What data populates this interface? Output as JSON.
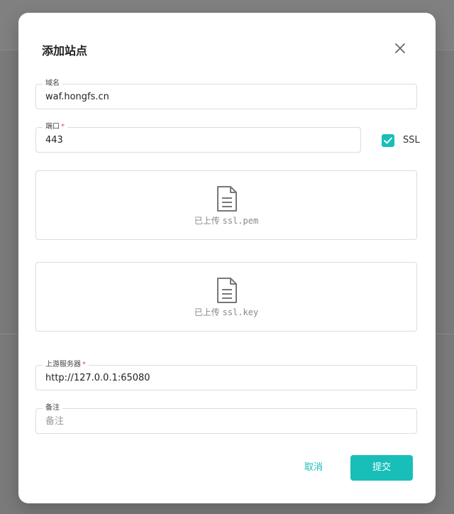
{
  "dialog": {
    "title": "添加站点",
    "close_icon": "close-icon"
  },
  "domain": {
    "label": "域名",
    "value": "waf.hongfs.cn",
    "required": false
  },
  "port": {
    "label": "端口",
    "required_mark": "*",
    "value": "443"
  },
  "ssl": {
    "label": "SSL",
    "checked": true,
    "color": "#18bfb8"
  },
  "uploads": [
    {
      "status": "已上传",
      "filename": "ssl.pem",
      "icon": "file-icon"
    },
    {
      "status": "已上传",
      "filename": "ssl.key",
      "icon": "file-icon"
    }
  ],
  "upstream": {
    "label": "上游服务器",
    "required_mark": "*",
    "value": "http://127.0.0.1:65080"
  },
  "remark": {
    "label": "备注",
    "placeholder": "备注",
    "value": ""
  },
  "actions": {
    "cancel_label": "取消",
    "submit_label": "提交"
  },
  "colors": {
    "accent": "#18bfb8",
    "required": "#e34d59",
    "overlay": "#7a7a7a"
  }
}
